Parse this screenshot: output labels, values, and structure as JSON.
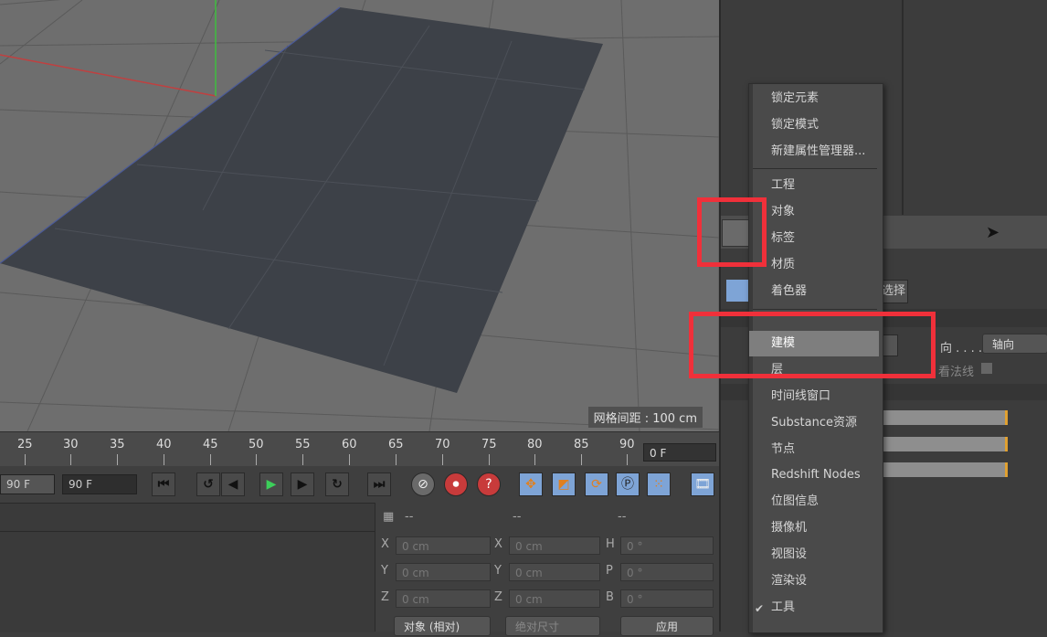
{
  "viewport": {
    "grid_info": "网格间距 : 100 cm"
  },
  "timeline": {
    "ticks": [
      "25",
      "30",
      "35",
      "40",
      "45",
      "50",
      "55",
      "60",
      "65",
      "70",
      "75",
      "80",
      "85",
      "90"
    ],
    "current_frame": "0 F"
  },
  "transport": {
    "start_field": "90 F",
    "end_field": "90 F"
  },
  "coords": {
    "header": [
      "--",
      "--",
      "--"
    ],
    "rows": [
      {
        "l1": "X",
        "v1": "0 cm",
        "l2": "X",
        "v2": "0 cm",
        "l3": "H",
        "v3": "0 °"
      },
      {
        "l1": "Y",
        "v1": "0 cm",
        "l2": "Y",
        "v2": "0 cm",
        "l3": "P",
        "v3": "0 °"
      },
      {
        "l1": "Z",
        "v1": "0 cm",
        "l2": "Z",
        "v2": "0 cm",
        "l3": "B",
        "v3": "0 °"
      }
    ],
    "mode_dropdown": "对象 (相对)",
    "size_dropdown": "绝对尺寸",
    "apply_button": "应用"
  },
  "right_panel": {
    "select_button": "选择",
    "axis_label": "向 . . . .",
    "axis_dropdown": "轴向",
    "normals_label": "看法线"
  },
  "menu": {
    "items": [
      "锁定元素",
      "锁定模式",
      "新建属性管理器...",
      "工程",
      "对象",
      "标签",
      "材质",
      "着色器",
      "建模",
      "层",
      "时间线窗口",
      "Substance资源",
      "节点",
      "Redshift Nodes",
      "位图信息",
      "摄像机",
      "视图设",
      "渲染设",
      "工具"
    ]
  },
  "colors": {
    "highlight": "#f0303a",
    "accent": "#7ea4d6",
    "marker": "#e0a030"
  }
}
